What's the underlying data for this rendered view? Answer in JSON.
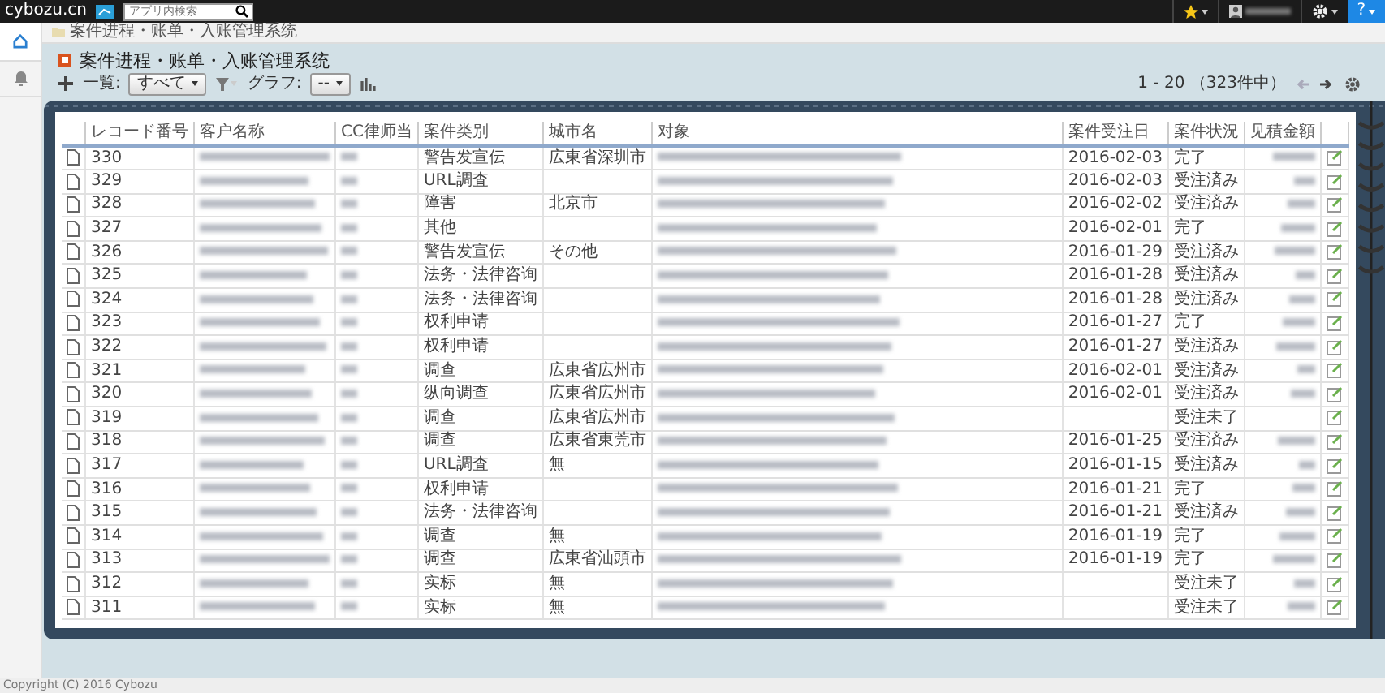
{
  "top_bar": {
    "logo": "cybozu.cn",
    "search": {
      "placeholder": "アプリ内検索"
    },
    "user_name_blurred": true,
    "help": "?"
  },
  "breadcrumb": "案件进程・账单・入账管理系统",
  "app_title": "案件进程・账单・入账管理系统",
  "toolbar": {
    "view_label": "一覧:",
    "view_value": "すべて",
    "graph_label": "グラフ:",
    "graph_value": "--",
    "pagination": "1 - 20 （323件中）",
    "prev_disabled": true,
    "next_disabled": false
  },
  "table": {
    "columns": [
      "レコード番号",
      "客户名称",
      "CC律师当",
      "案件类别",
      "城市名",
      "对象",
      "案件受注日",
      "案件状況",
      "见積金額"
    ],
    "rows": [
      {
        "record_no": "330",
        "customer_blurred": true,
        "cc_blurred": true,
        "case_type": "警告发宣伝",
        "city": "広東省深圳市",
        "target_blurred": true,
        "received": "2016-02-03",
        "status": "完了",
        "amount_blurred": true
      },
      {
        "record_no": "329",
        "customer_blurred": true,
        "cc_blurred": true,
        "case_type": "URL調査",
        "target_blurred": true,
        "received": "2016-02-03",
        "status": "受注済み",
        "amount_blurred": true
      },
      {
        "record_no": "328",
        "customer_blurred": true,
        "cc_blurred": true,
        "case_type": "障害",
        "city": "北京市",
        "target_blurred": true,
        "received": "2016-02-02",
        "status": "受注済み",
        "amount_blurred": true
      },
      {
        "record_no": "327",
        "customer_blurred": true,
        "cc_blurred": true,
        "case_type": "其他",
        "target_blurred": true,
        "received": "2016-02-01",
        "status": "完了",
        "amount_blurred": true
      },
      {
        "record_no": "326",
        "customer_blurred": true,
        "cc_blurred": true,
        "case_type": "警告发宣伝",
        "city": "その他",
        "target_blurred": true,
        "received": "2016-01-29",
        "status": "受注済み",
        "amount_blurred": true
      },
      {
        "record_no": "325",
        "customer_blurred": true,
        "cc_blurred": true,
        "case_type": "法务・法律咨询",
        "target_blurred": true,
        "received": "2016-01-28",
        "status": "受注済み",
        "amount_blurred": true
      },
      {
        "record_no": "324",
        "customer_blurred": true,
        "cc_blurred": true,
        "case_type": "法务・法律咨询",
        "target_blurred": true,
        "received": "2016-01-28",
        "status": "受注済み",
        "amount_blurred": true
      },
      {
        "record_no": "323",
        "customer_blurred": true,
        "cc_blurred": true,
        "case_type": "权利申请",
        "target_blurred": true,
        "received": "2016-01-27",
        "status": "完了",
        "amount_blurred": true
      },
      {
        "record_no": "322",
        "customer_blurred": true,
        "cc_blurred": true,
        "case_type": "权利申请",
        "target_blurred": true,
        "received": "2016-01-27",
        "status": "受注済み",
        "amount_blurred": true
      },
      {
        "record_no": "321",
        "customer_blurred": true,
        "cc_blurred": true,
        "case_type": "调查",
        "city": "広東省広州市",
        "target_blurred": true,
        "received": "2016-02-01",
        "status": "受注済み",
        "amount_blurred": true
      },
      {
        "record_no": "320",
        "customer_blurred": true,
        "cc_blurred": true,
        "case_type": "纵向调查",
        "city": "広東省広州市",
        "target_blurred": true,
        "received": "2016-02-01",
        "status": "受注済み",
        "amount_blurred": true
      },
      {
        "record_no": "319",
        "customer_blurred": true,
        "cc_blurred": true,
        "case_type": "调查",
        "city": "広東省広州市",
        "target_blurred": true,
        "status": "受注未了",
        "amount_blurred": false
      },
      {
        "record_no": "318",
        "customer_blurred": true,
        "cc_blurred": true,
        "case_type": "调查",
        "city": "広東省東莞市",
        "target_blurred": true,
        "received": "2016-01-25",
        "status": "受注済み",
        "amount_blurred": true
      },
      {
        "record_no": "317",
        "customer_blurred": true,
        "cc_blurred": true,
        "case_type": "URL調査",
        "city": "無",
        "target_blurred": true,
        "received": "2016-01-15",
        "status": "受注済み",
        "amount_blurred": true
      },
      {
        "record_no": "316",
        "customer_blurred": true,
        "cc_blurred": true,
        "case_type": "权利申请",
        "target_blurred": true,
        "received": "2016-01-21",
        "status": "完了",
        "amount_blurred": true
      },
      {
        "record_no": "315",
        "customer_blurred": true,
        "cc_blurred": true,
        "case_type": "法务・法律咨询",
        "target_blurred": true,
        "received": "2016-01-21",
        "status": "受注済み",
        "amount_blurred": true
      },
      {
        "record_no": "314",
        "customer_blurred": true,
        "cc_blurred": true,
        "case_type": "调查",
        "city": "無",
        "target_blurred": true,
        "received": "2016-01-19",
        "status": "完了",
        "amount_blurred": true
      },
      {
        "record_no": "313",
        "customer_blurred": true,
        "cc_blurred": true,
        "case_type": "调查",
        "city": "広東省汕頭市",
        "target_blurred": true,
        "received": "2016-01-19",
        "status": "完了",
        "amount_blurred": true
      },
      {
        "record_no": "312",
        "customer_blurred": true,
        "cc_blurred": true,
        "case_type": "实标",
        "city": "無",
        "target_blurred": true,
        "status": "受注未了",
        "amount_blurred": true
      },
      {
        "record_no": "311",
        "customer_blurred": true,
        "cc_blurred": true,
        "case_type": "实标",
        "city": "無",
        "target_blurred": true,
        "status": "受注未了",
        "amount_blurred": true
      }
    ]
  },
  "footer": "Copyright (C) 2016 Cybozu"
}
